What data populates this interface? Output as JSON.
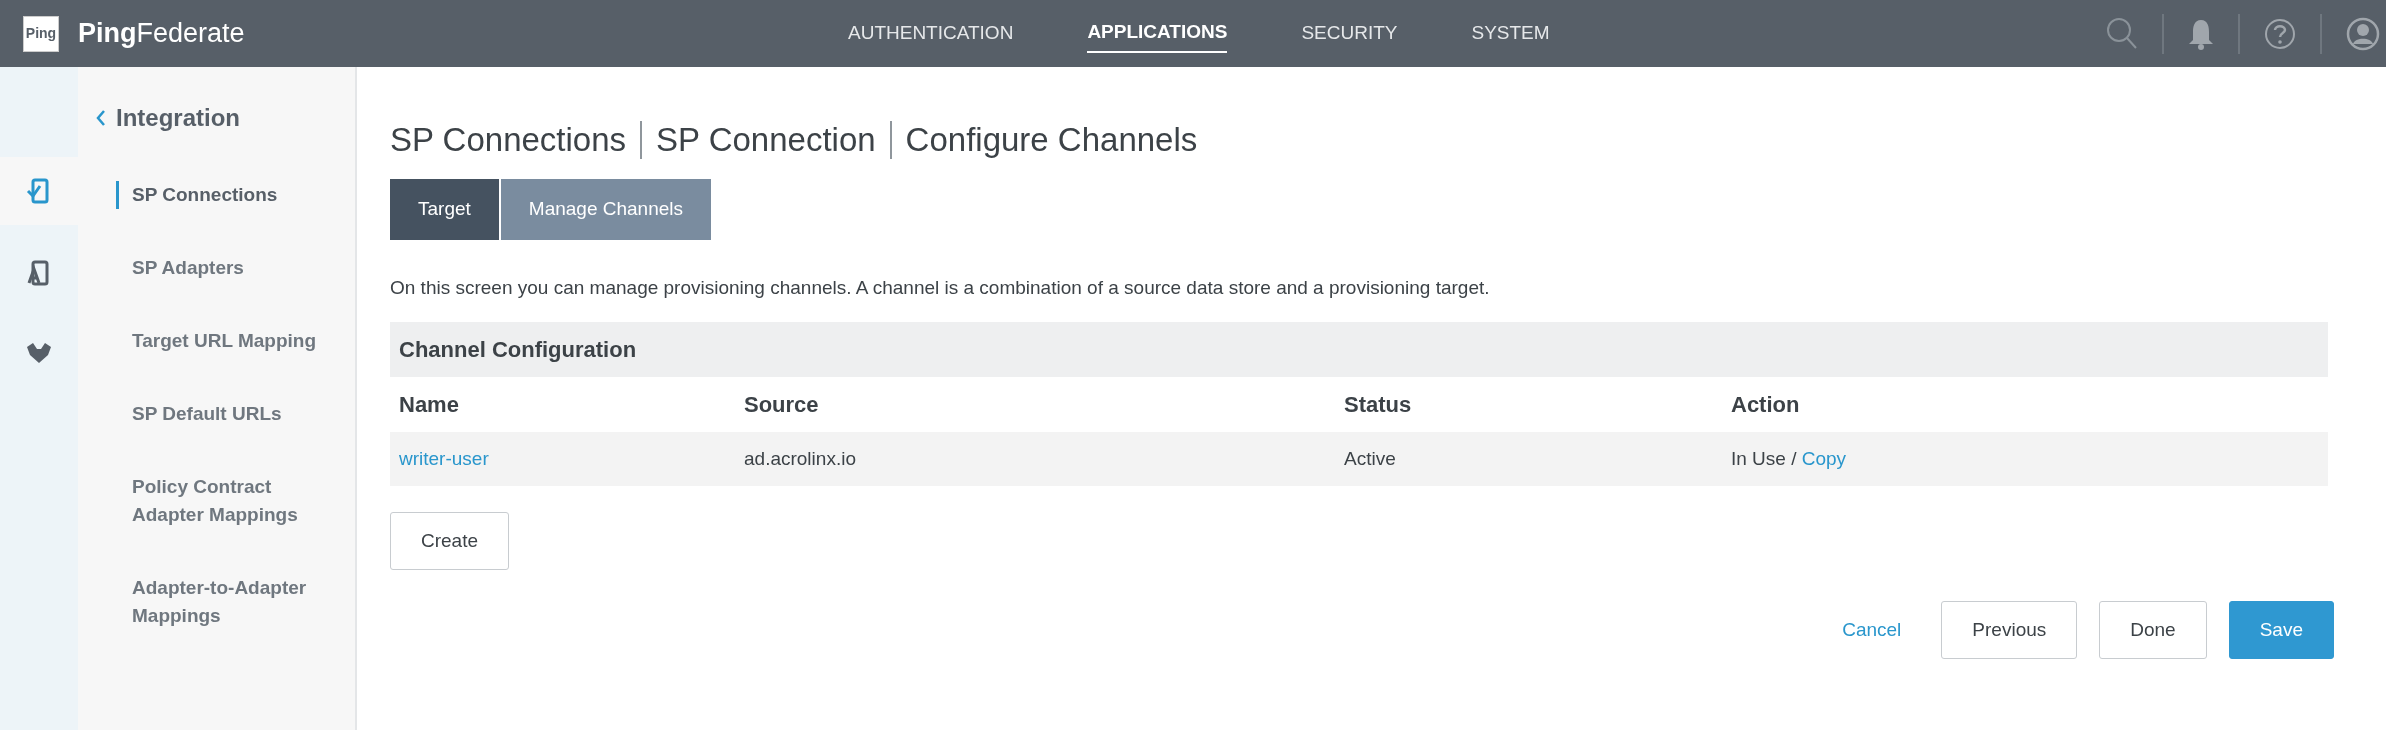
{
  "header": {
    "logo_text": "Ping",
    "brand_bold": "Ping",
    "brand_light": "Federate",
    "nav": [
      {
        "label": "AUTHENTICATION",
        "selected": false
      },
      {
        "label": "APPLICATIONS",
        "selected": true
      },
      {
        "label": "SECURITY",
        "selected": false
      },
      {
        "label": "SYSTEM",
        "selected": false
      }
    ]
  },
  "rail": [
    {
      "kind": "connections",
      "selected": true
    },
    {
      "kind": "adapters",
      "selected": false
    },
    {
      "kind": "mapping",
      "selected": false
    }
  ],
  "sidebar": {
    "title": "Integration",
    "items": [
      {
        "label": "SP Connections",
        "selected": true
      },
      {
        "label": "SP Adapters",
        "selected": false
      },
      {
        "label": "Target URL Mapping",
        "selected": false
      },
      {
        "label": "SP Default URLs",
        "selected": false
      },
      {
        "label": "Policy Contract Adapter Mappings",
        "selected": false
      },
      {
        "label": "Adapter-to-Adapter Mappings",
        "selected": false
      }
    ]
  },
  "breadcrumb": [
    "SP Connections",
    "SP Connection",
    "Configure Channels"
  ],
  "tabs": [
    {
      "label": "Target",
      "selected": false
    },
    {
      "label": "Manage Channels",
      "selected": true
    }
  ],
  "description": "On this screen you can manage provisioning channels. A channel is a combination of a source data store and a provisioning target.",
  "table": {
    "title": "Channel Configuration",
    "columns": [
      "Name",
      "Source",
      "Status",
      "Action"
    ],
    "rows": [
      {
        "name": "writer-user",
        "source": "ad.acrolinx.io",
        "status": "Active",
        "action_text": "In Use /",
        "action_link": "Copy"
      }
    ]
  },
  "create_button": "Create",
  "footer": {
    "cancel": "Cancel",
    "buttons": [
      {
        "label": "Previous",
        "kind": "secondary"
      },
      {
        "label": "Done",
        "kind": "secondary"
      },
      {
        "label": "Save",
        "kind": "primary"
      }
    ]
  }
}
